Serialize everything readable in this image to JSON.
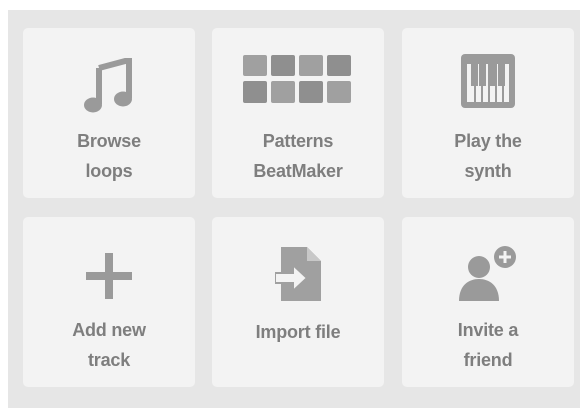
{
  "tiles": [
    {
      "label": "Browse\nloops",
      "icon": "music-note-icon"
    },
    {
      "label": "Patterns\nBeatMaker",
      "icon": "pads-grid-icon"
    },
    {
      "label": "Play the\nsynth",
      "icon": "piano-keys-icon"
    },
    {
      "label": "Add new\ntrack",
      "icon": "plus-icon"
    },
    {
      "label": "Import file",
      "icon": "import-file-icon"
    },
    {
      "label": "Invite a\nfriend",
      "icon": "add-user-icon"
    }
  ],
  "colors": {
    "panel_bg": "#e6e6e6",
    "tile_bg": "#f3f3f3",
    "text": "#7e7e7e",
    "icon": "#9a9a9a"
  }
}
